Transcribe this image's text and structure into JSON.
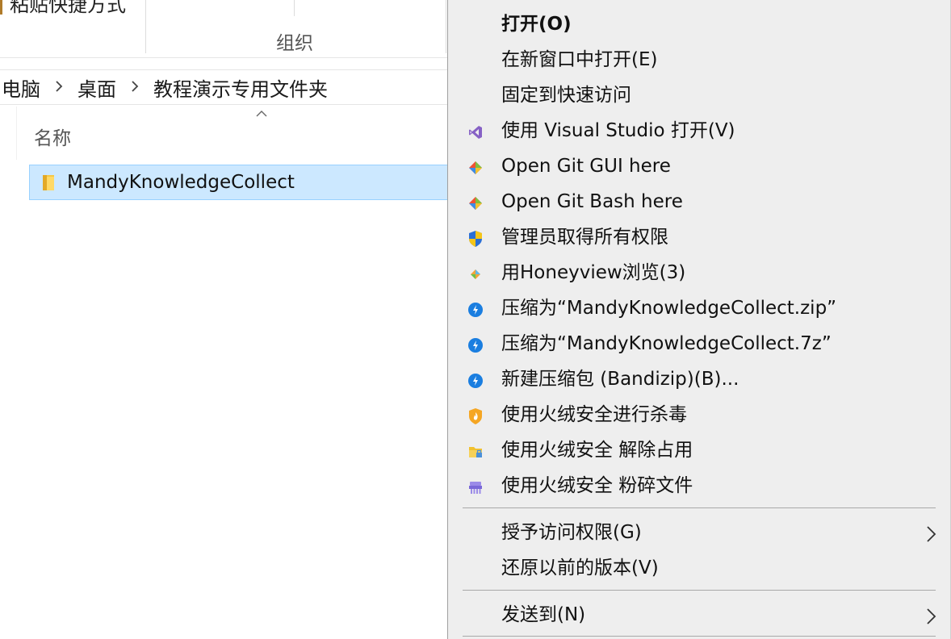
{
  "explorer": {
    "ribbon_partial_text": "粘贴快捷方式",
    "ribbon_group_label": "组织",
    "breadcrumb": [
      "电脑",
      "桌面",
      "教程演示专用文件夹"
    ],
    "column_name_header": "名称",
    "selected_item": "MandyKnowledgeCollect"
  },
  "context_menu": {
    "items": [
      {
        "label": "打开(O)",
        "icon": "none",
        "bold": true
      },
      {
        "label": "在新窗口中打开(E)",
        "icon": "none"
      },
      {
        "label": "固定到快速访问",
        "icon": "none"
      },
      {
        "label": "使用 Visual Studio 打开(V)",
        "icon": "visual-studio-icon"
      },
      {
        "label": "Open Git GUI here",
        "icon": "git-gui-icon"
      },
      {
        "label": "Open Git Bash here",
        "icon": "git-bash-icon"
      },
      {
        "label": "管理员取得所有权限",
        "icon": "uac-shield-icon"
      },
      {
        "label": "用Honeyview浏览(3)",
        "icon": "honeyview-icon"
      },
      {
        "label": "压缩为“MandyKnowledgeCollect.zip”",
        "icon": "bandizip-icon"
      },
      {
        "label": "压缩为“MandyKnowledgeCollect.7z”",
        "icon": "bandizip-icon"
      },
      {
        "label": "新建压缩包 (Bandizip)(B)...",
        "icon": "bandizip-icon"
      },
      {
        "label": "使用火绒安全进行杀毒",
        "icon": "huorong-icon"
      },
      {
        "label": "使用火绒安全 解除占用",
        "icon": "unlock-file-icon"
      },
      {
        "label": "使用火绒安全 粉碎文件",
        "icon": "shredder-icon"
      },
      {
        "label": "授予访问权限(G)",
        "icon": "none",
        "submenu": true
      },
      {
        "label": "还原以前的版本(V)",
        "icon": "none"
      },
      {
        "label": "发送到(N)",
        "icon": "none",
        "submenu": true
      }
    ]
  },
  "colors": {
    "menu_bg": "#eeeeee",
    "selection_bg": "#cce8ff",
    "selection_border": "#99d1ff",
    "bandizip_blue": "#1a7ee0",
    "vs_purple": "#8661c5"
  }
}
